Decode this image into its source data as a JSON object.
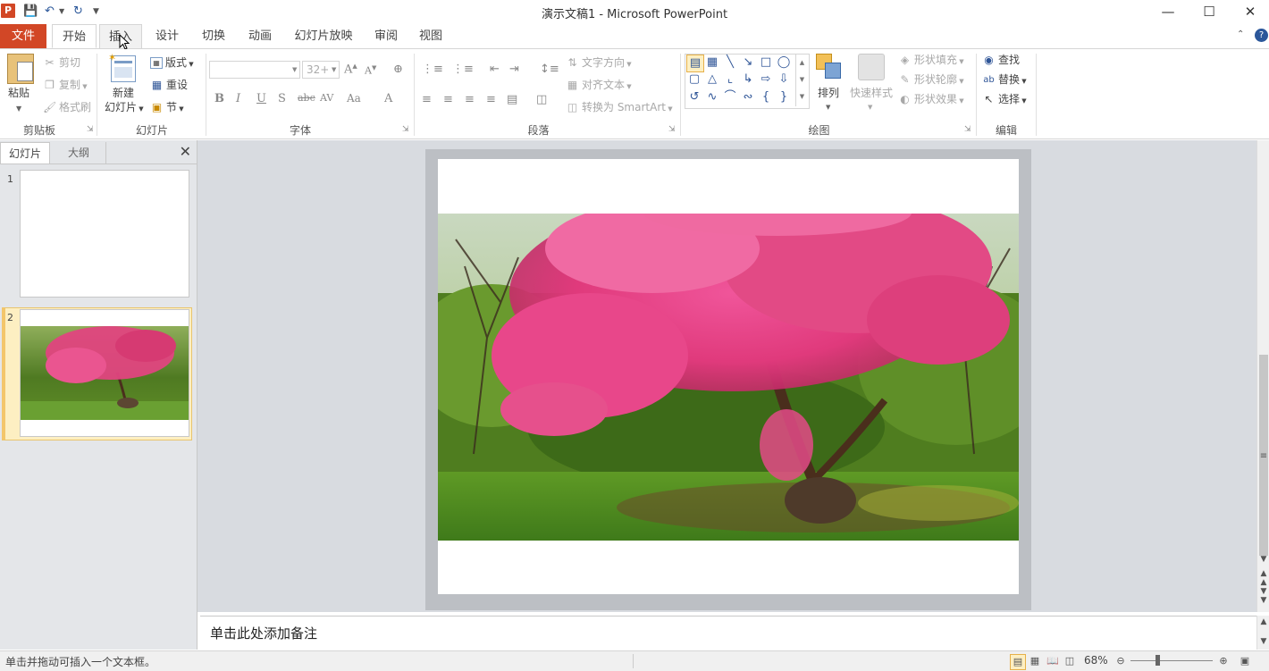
{
  "window": {
    "title": "演示文稿1 - Microsoft PowerPoint",
    "app_icon": "P"
  },
  "tabs": [
    "文件",
    "开始",
    "插入",
    "设计",
    "切换",
    "动画",
    "幻灯片放映",
    "审阅",
    "视图"
  ],
  "ribbon": {
    "clipboard": {
      "label": "剪贴板",
      "paste": "粘贴",
      "cut": "剪切",
      "copy": "复制",
      "format_painter": "格式刷"
    },
    "slides": {
      "label": "幻灯片",
      "new_slide_1": "新建",
      "new_slide_2": "幻灯片",
      "layout": "版式",
      "reset": "重设",
      "section": "节"
    },
    "font": {
      "label": "字体",
      "font_name": "",
      "font_size": "32+"
    },
    "paragraph": {
      "label": "段落",
      "text_direction": "文字方向",
      "align_text": "对齐文本",
      "convert_smartart": "转换为 SmartArt"
    },
    "drawing": {
      "label": "绘图",
      "arrange": "排列",
      "quick_styles": "快速样式",
      "shape_fill": "形状填充",
      "shape_outline": "形状轮廓",
      "shape_effects": "形状效果"
    },
    "editing": {
      "label": "编辑",
      "find": "查找",
      "replace": "替换",
      "select": "选择"
    }
  },
  "left_pane": {
    "tabs": [
      "幻灯片",
      "大纲"
    ],
    "slides": [
      {
        "number": "1"
      },
      {
        "number": "2"
      }
    ],
    "selected_slide": 2
  },
  "notes": {
    "placeholder": "单击此处添加备注"
  },
  "statusbar": {
    "message": "单击并拖动可插入一个文本框。",
    "zoom": "68%"
  },
  "colors": {
    "file_tab": "#d24726",
    "accent": "#2b579a",
    "selection": "#fdefc2"
  }
}
